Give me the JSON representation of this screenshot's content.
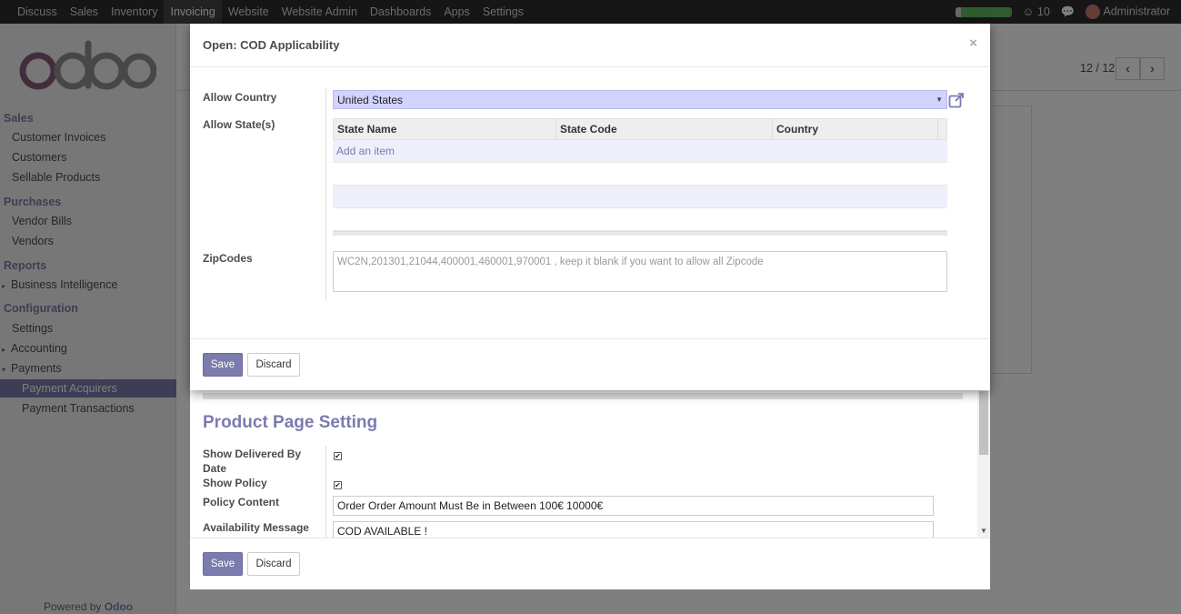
{
  "topbar": {
    "menu": [
      "Discuss",
      "Sales",
      "Inventory",
      "Invoicing",
      "Website",
      "Website Admin",
      "Dashboards",
      "Apps",
      "Settings"
    ],
    "active_menu": "Invoicing",
    "progress_fraction": 0.11,
    "notification_count": "10",
    "user": "Administrator"
  },
  "sidebar": {
    "sections": [
      {
        "title": "Sales",
        "items": [
          "Customer Invoices",
          "Customers",
          "Sellable Products"
        ]
      },
      {
        "title": "Purchases",
        "items": [
          "Vendor Bills",
          "Vendors"
        ]
      },
      {
        "title": "Reports",
        "items": [
          "Business Intelligence"
        ]
      },
      {
        "title": "Configuration",
        "items": [
          "Settings",
          "Accounting",
          "Payments",
          "Payment Acquirers",
          "Payment Transactions"
        ]
      }
    ],
    "powered_prefix": "Powered by",
    "powered_brand": "Odoo"
  },
  "pager": {
    "text": "12 / 12"
  },
  "dialog": {
    "title": "Open: COD Applicability",
    "allow_country_label": "Allow Country",
    "country_value": "United States",
    "allow_states_label": "Allow State(s)",
    "columns": [
      "State Name",
      "State Code",
      "Country"
    ],
    "add_item": "Add an item",
    "zipcodes_label": "ZipCodes",
    "zip_placeholder": "WC2N,201301,21044,400001,460001,970001  , keep it blank if you want to allow all Zipcode",
    "save": "Save",
    "discard": "Discard"
  },
  "back_dialog": {
    "section_title": "Product Page Setting",
    "show_delivered_label": "Show Delivered By Date",
    "show_delivered_checked": true,
    "show_policy_label": "Show Policy",
    "show_policy_checked": true,
    "policy_content_label": "Policy Content",
    "policy_content_value": "Order Order Amount Must Be in Between 100€ 10000€",
    "availability_label": "Availability Message",
    "availability_value": "COD AVAILABLE !",
    "save": "Save",
    "discard": "Discard"
  },
  "colors": {
    "brand": "#7c7bad",
    "country_field_bg": "#d2d2ff"
  }
}
